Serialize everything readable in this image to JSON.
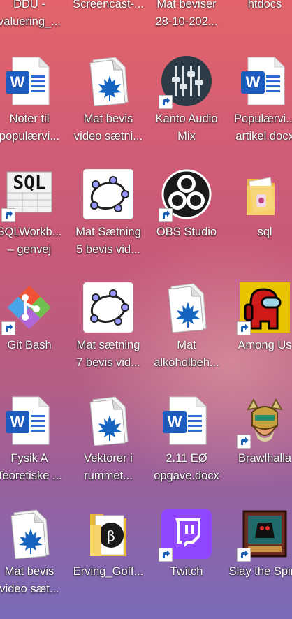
{
  "desktop": {
    "top_row": [
      {
        "line1": "DDU -",
        "line2": "valuering_..."
      },
      {
        "line1": "Screencast-...",
        "line2": ""
      },
      {
        "line1": "Mat beviser",
        "line2": "28-10-202..."
      },
      {
        "line1": "htdocs",
        "line2": ""
      }
    ],
    "icons": [
      {
        "icon": "word-document-icon",
        "line1": "Noter til",
        "line2": "populærvi..."
      },
      {
        "icon": "maple-document-icon",
        "line1": "Mat bevis",
        "line2": "video sætni..."
      },
      {
        "icon": "kanto-audio-mix-icon",
        "line1": "Kanto Audio",
        "line2": "Mix"
      },
      {
        "icon": "word-document-icon",
        "line1": "Populærvi...",
        "line2": "artikel.docx"
      },
      {
        "icon": "sql-workbench-icon",
        "line1": "SQLWorkb...",
        "line2": "– genvej"
      },
      {
        "icon": "geogebra-icon",
        "line1": "Mat Sætning",
        "line2": "5 bevis vid..."
      },
      {
        "icon": "obs-studio-icon",
        "line1": "OBS Studio",
        "line2": ""
      },
      {
        "icon": "folder-icon",
        "line1": "sql",
        "line2": ""
      },
      {
        "icon": "git-bash-icon",
        "line1": "Git Bash",
        "line2": ""
      },
      {
        "icon": "geogebra-icon",
        "line1": "Mat sætning",
        "line2": "7 bevis vid..."
      },
      {
        "icon": "maple-document-icon",
        "line1": "Mat",
        "line2": "alkoholbeh..."
      },
      {
        "icon": "among-us-icon",
        "line1": "Among Us",
        "line2": ""
      },
      {
        "icon": "word-document-icon",
        "line1": "Fysik A",
        "line2": "Teoretiske ..."
      },
      {
        "icon": "maple-document-icon",
        "line1": "Vektorer i",
        "line2": "rummet..."
      },
      {
        "icon": "word-document-icon",
        "line1": "2.11 EØ",
        "line2": "opgave.docx"
      },
      {
        "icon": "brawlhalla-icon",
        "line1": "Brawlhalla",
        "line2": ""
      },
      {
        "icon": "maple-document-icon",
        "line1": "Mat bevis",
        "line2": "video sæt..."
      },
      {
        "icon": "folder-image-icon",
        "line1": "Erving_Goff...",
        "line2": ""
      },
      {
        "icon": "twitch-icon",
        "line1": "Twitch",
        "line2": ""
      },
      {
        "icon": "slay-the-spire-icon",
        "line1": "Slay the Spire",
        "line2": ""
      }
    ]
  }
}
